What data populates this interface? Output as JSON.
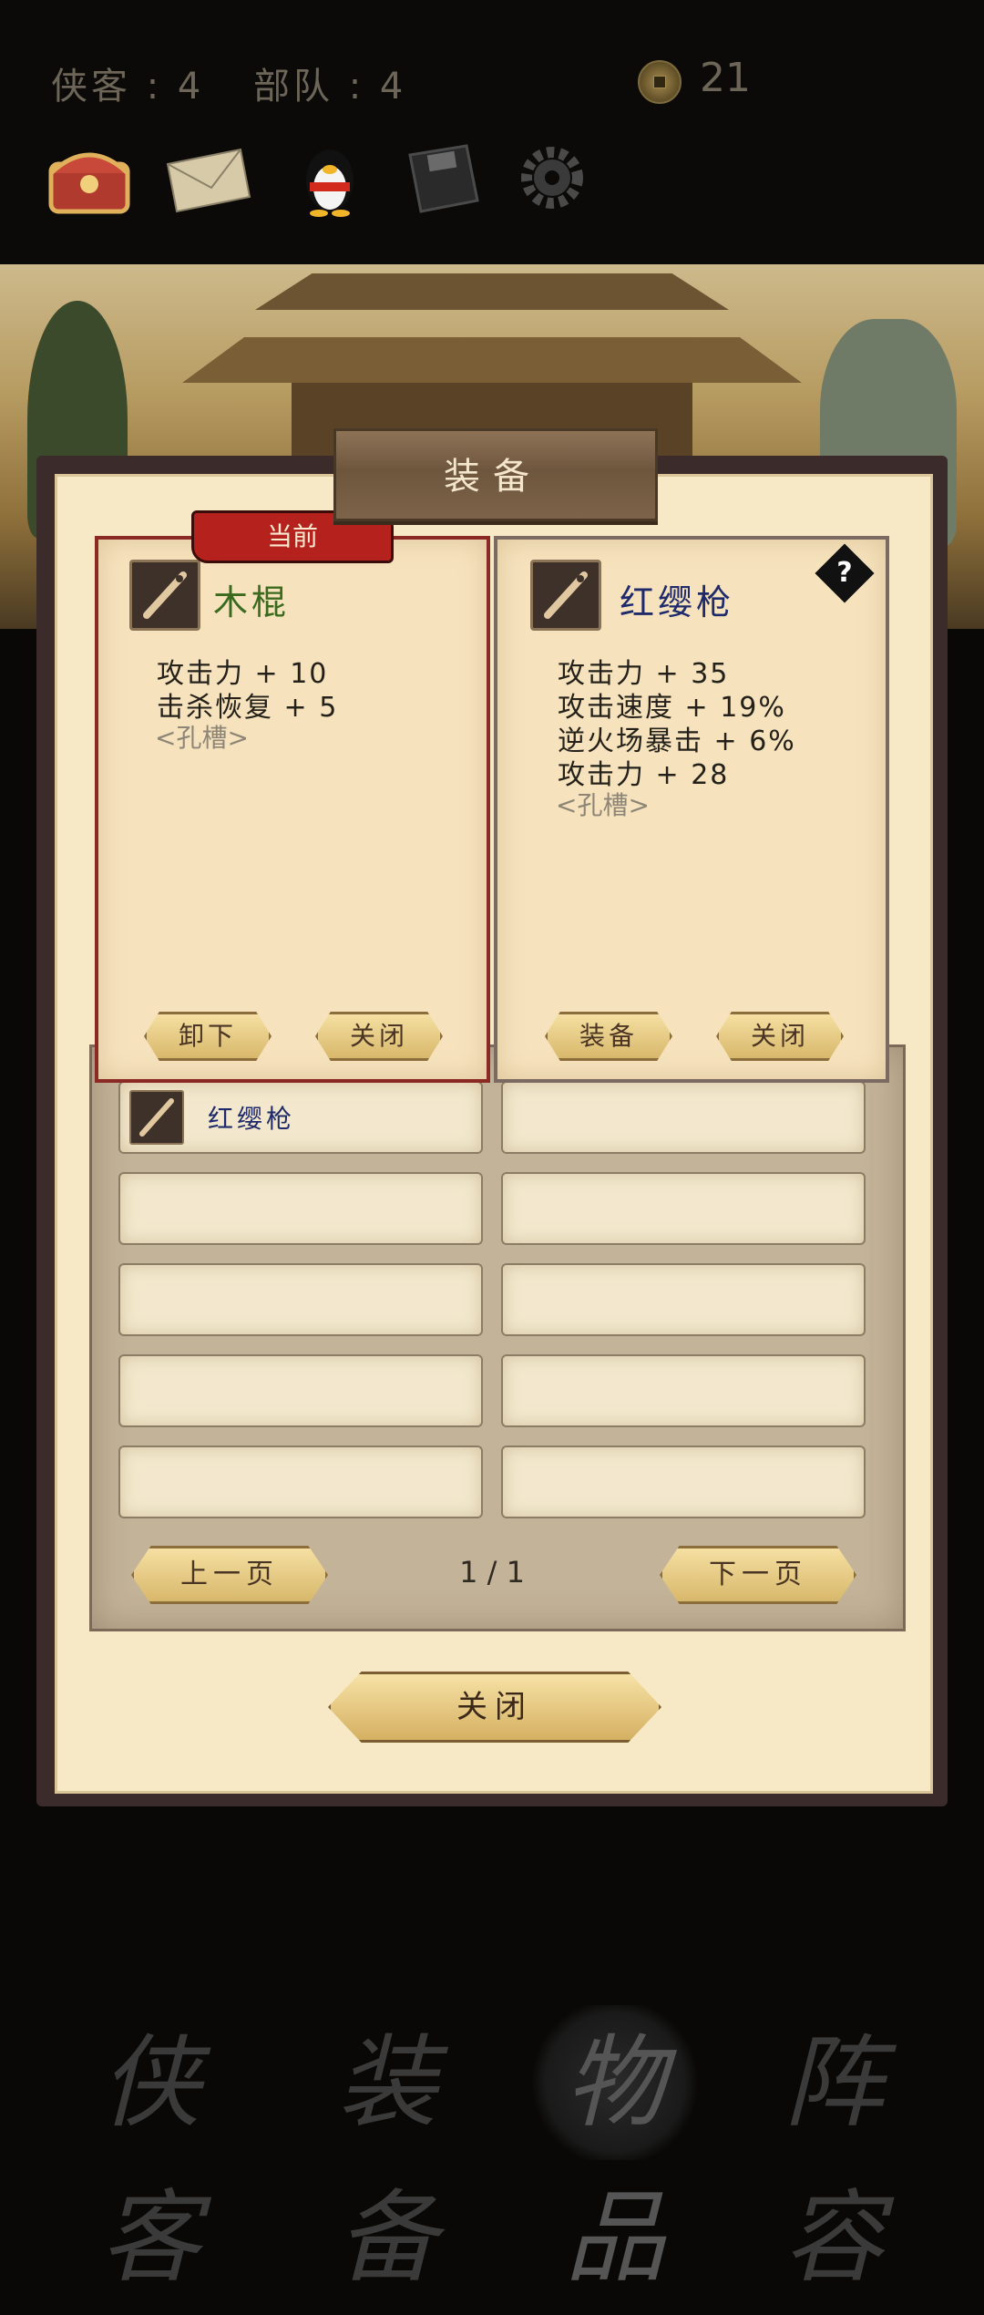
{
  "top": {
    "heroes_label": "侠客",
    "heroes_value": "4",
    "troops_label": "部队",
    "troops_value": "4",
    "coins": "21",
    "icons": [
      "treasure-chest-icon",
      "mail-icon",
      "qq-penguin-icon",
      "save-disk-icon",
      "settings-gear-icon"
    ]
  },
  "dialog": {
    "title": "装备",
    "current_tag": "当前",
    "current_item": {
      "name": "木棍",
      "stats": [
        "攻击力 + 10",
        "击杀恢复 + 5"
      ],
      "socket": "<孔槽>",
      "btn_unequip": "卸下",
      "btn_close": "关闭"
    },
    "selected_item": {
      "name": "红缨枪",
      "stats": [
        "攻击力 + 35",
        "攻击速度 + 19%",
        "逆火场暴击 + 6%",
        "攻击力 + 28"
      ],
      "socket": "<孔槽>",
      "btn_equip": "装备",
      "btn_close": "关闭",
      "help": "?"
    },
    "inventory": {
      "slots": [
        {
          "label": "红缨枪",
          "has_item": true
        },
        {
          "label": "",
          "has_item": false
        },
        {
          "label": "",
          "has_item": false
        },
        {
          "label": "",
          "has_item": false
        },
        {
          "label": "",
          "has_item": false
        },
        {
          "label": "",
          "has_item": false
        },
        {
          "label": "",
          "has_item": false
        },
        {
          "label": "",
          "has_item": false
        },
        {
          "label": "",
          "has_item": false
        },
        {
          "label": "",
          "has_item": false
        }
      ],
      "prev_label": "上一页",
      "next_label": "下一页",
      "page": "1 / 1"
    },
    "close_label": "关闭"
  },
  "nav": {
    "items": [
      {
        "label": "侠客"
      },
      {
        "label": "装备"
      },
      {
        "label": "物品",
        "active": true
      },
      {
        "label": "阵容"
      }
    ]
  },
  "colors": {
    "current_name": "#3a6a1e",
    "selected_name": "#1f2a6b",
    "card_border": "#8b2a25",
    "tag_red": "#b5221d"
  }
}
